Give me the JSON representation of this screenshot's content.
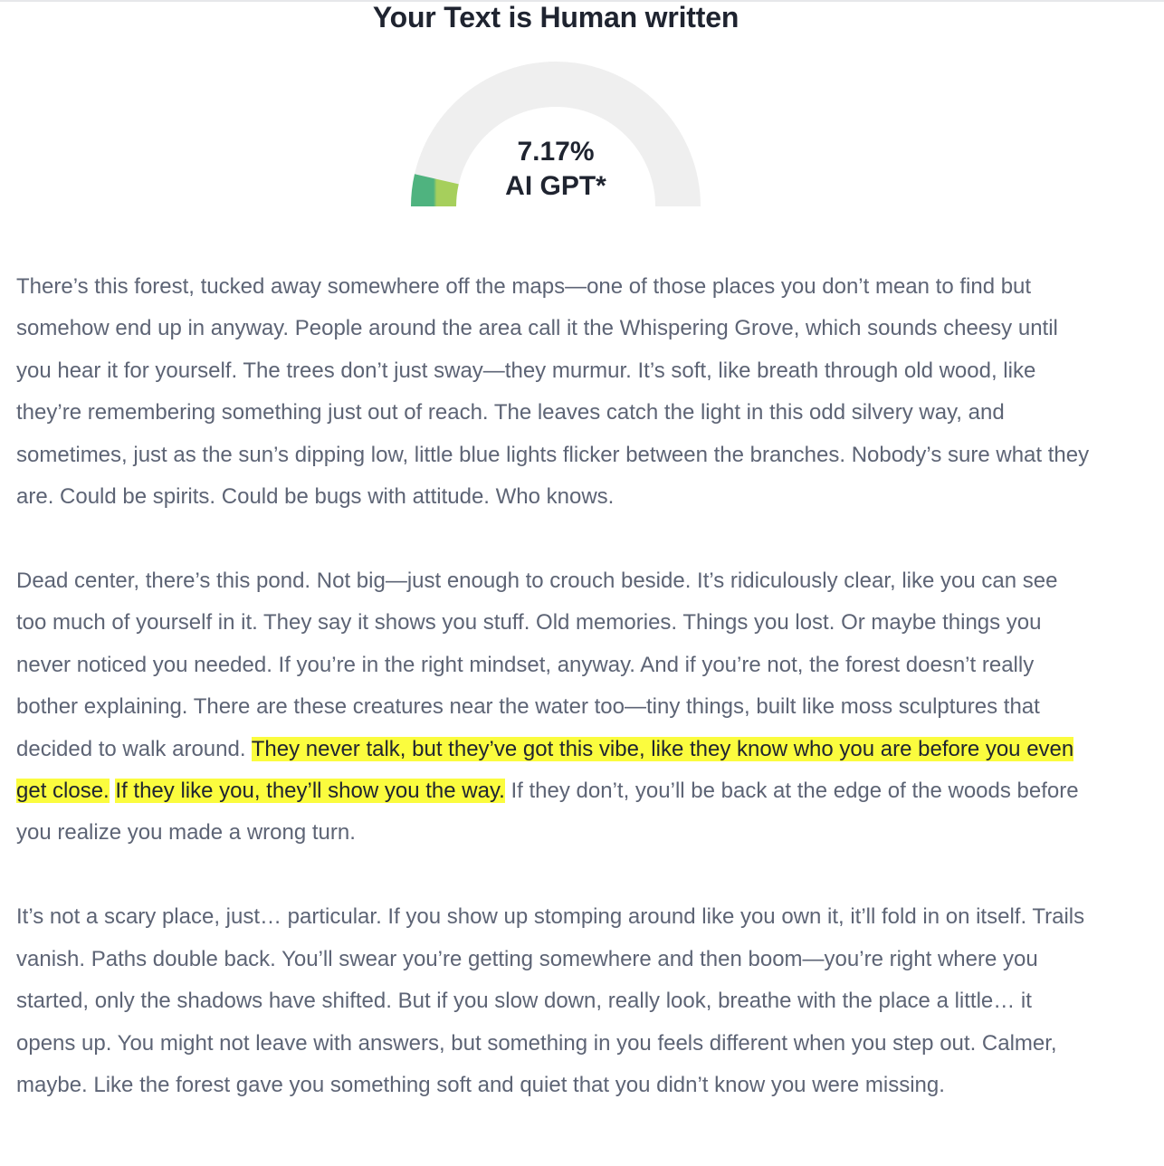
{
  "result": {
    "title": "Your Text is Human written",
    "ai_percent_label": "7.17%",
    "ai_percent_value": 7.17,
    "model_label": "AI GPT*"
  },
  "colors": {
    "gauge_track": "#efefef",
    "gauge_fill_start": "#4fb37f",
    "gauge_fill_end": "#a6cf5c",
    "highlight": "#fbfc3e"
  },
  "paragraphs": [
    [
      {
        "text": "There’s this forest, tucked away somewhere off the maps—one of those places you don’t mean to find but somehow end up in anyway. People around the area call it the Whispering Grove, which sounds cheesy until you hear it for yourself. The trees don’t just sway—they murmur. It’s soft, like breath through old wood, like they’re remembering something just out of reach. The leaves catch the light in this odd silvery way, and sometimes, just as the sun’s dipping low, little blue lights flicker between the branches. Nobody’s sure what they are. Could be spirits. Could be bugs with attitude. Who knows.",
        "highlight": false
      }
    ],
    [
      {
        "text": "Dead center, there’s this pond. Not big—just enough to crouch beside. It’s ridiculously clear, like you can see too much of yourself in it. They say it shows you stuff. Old memories. Things you lost. Or maybe things you never noticed you needed. If you’re in the right mindset, anyway. And if you’re not, the forest doesn’t really bother explaining. There are these creatures near the water too—tiny things, built like moss sculptures that decided to walk around. ",
        "highlight": false
      },
      {
        "text": "They never talk, but they’ve got this vibe, like they know who you are before you even get close.",
        "highlight": true
      },
      {
        "text": " ",
        "highlight": false
      },
      {
        "text": "If they like you, they’ll show you the way.",
        "highlight": true
      },
      {
        "text": " If they don’t, you’ll be back at the edge of the woods before you realize you made a wrong turn.",
        "highlight": false
      }
    ],
    [
      {
        "text": "It’s not a scary place, just… particular. If you show up stomping around like you own it, it’ll fold in on itself. Trails vanish. Paths double back. You’ll swear you’re getting somewhere and then boom—you’re right where you started, only the shadows have shifted. But if you slow down, really look, breathe with the place a little… it opens up. You might not leave with answers, but something in you feels different when you step out. Calmer, maybe. Like the forest gave you something soft and quiet that you didn’t know you were missing.",
        "highlight": false
      }
    ]
  ]
}
